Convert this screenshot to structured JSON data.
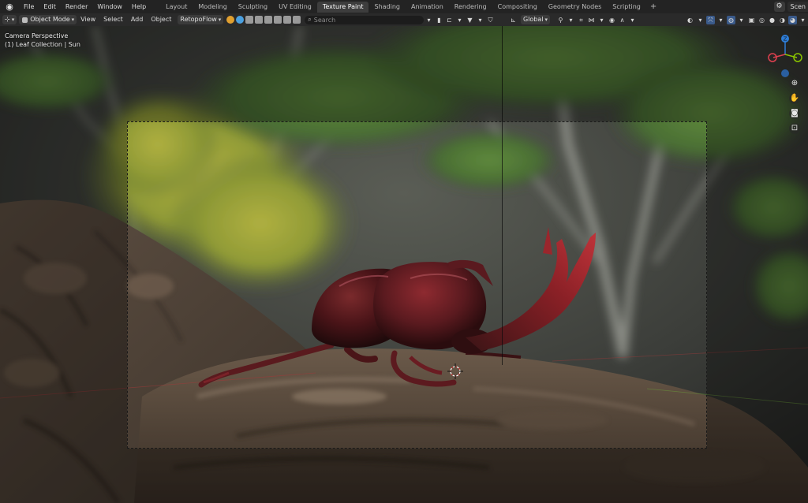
{
  "topbar": {
    "menus": [
      "File",
      "Edit",
      "Render",
      "Window",
      "Help"
    ],
    "workspaces": [
      "Layout",
      "Modeling",
      "Sculpting",
      "UV Editing",
      "Texture Paint",
      "Shading",
      "Animation",
      "Rendering",
      "Compositing",
      "Geometry Nodes",
      "Scripting"
    ],
    "active_workspace": "Texture Paint",
    "add_tab": "+",
    "scene": "Scen"
  },
  "header": {
    "mode": "Object Mode",
    "menus": [
      "View",
      "Select",
      "Add",
      "Object"
    ],
    "addon_dropdown": "RetopoFlow",
    "search_placeholder": "Search",
    "orientation": "Global"
  },
  "viewport": {
    "line1": "Camera Perspective",
    "line2": "(1) Leaf Collection | Sun",
    "gizmo": {
      "z": "Z",
      "x_color": "#e0404f",
      "y_color": "#8bc400",
      "z_color": "#2e7dd6"
    }
  },
  "colors": {
    "menubar": "#232323",
    "header": "#2a2a2a",
    "active_tab": "#3d3d3d"
  }
}
